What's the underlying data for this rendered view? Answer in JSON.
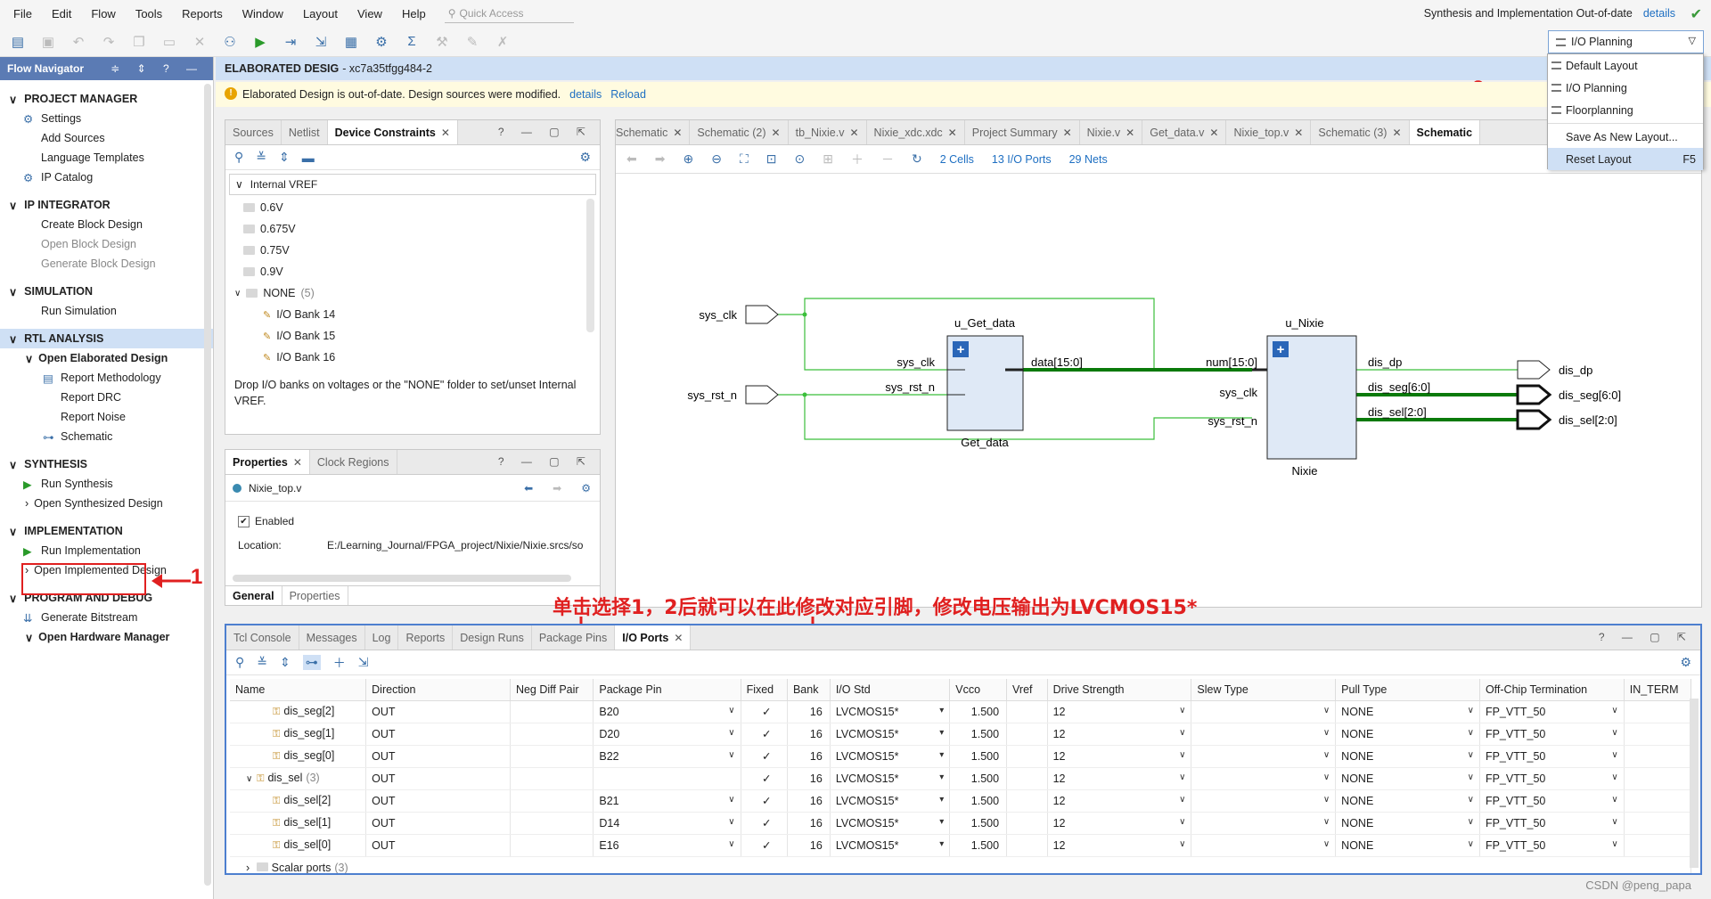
{
  "menubar": {
    "items": [
      "File",
      "Edit",
      "Flow",
      "Tools",
      "Reports",
      "Window",
      "Layout",
      "View",
      "Help"
    ],
    "quick_access_placeholder": "Quick Access",
    "status_text": "Synthesis and Implementation Out-of-date",
    "status_link": "details"
  },
  "toolbar": {
    "layout_selected": "I/O Planning"
  },
  "layout_menu": {
    "items": [
      "Default Layout",
      "I/O Planning",
      "Floorplanning",
      "Save As New Layout...",
      "Reset Layout"
    ],
    "reset_shortcut": "F5"
  },
  "flow_navigator": {
    "title": "Flow Navigator",
    "sections": [
      {
        "label": "PROJECT MANAGER",
        "items": [
          "Settings",
          "Add Sources",
          "Language Templates",
          "IP Catalog"
        ]
      },
      {
        "label": "IP INTEGRATOR",
        "items": [
          "Create Block Design",
          "Open Block Design",
          "Generate Block Design"
        ]
      },
      {
        "label": "SIMULATION",
        "items": [
          "Run Simulation"
        ]
      },
      {
        "label": "RTL ANALYSIS",
        "items": [
          "Open Elaborated Design",
          "Report Methodology",
          "Report DRC",
          "Report Noise",
          "Schematic"
        ]
      },
      {
        "label": "SYNTHESIS",
        "items": [
          "Run Synthesis",
          "Open Synthesized Design"
        ]
      },
      {
        "label": "IMPLEMENTATION",
        "items": [
          "Run Implementation",
          "Open Implemented Design"
        ]
      },
      {
        "label": "PROGRAM AND DEBUG",
        "items": [
          "Generate Bitstream",
          "Open Hardware Manager"
        ]
      }
    ]
  },
  "design_header": {
    "title": "ELABORATED DESIG",
    "part": "- xc7a35tfgg484-2",
    "warning": "Elaborated Design is out-of-date. Design sources were modified.",
    "details_link": "details",
    "reload_link": "Reload"
  },
  "device_constraints": {
    "tabs": [
      "Sources",
      "Netlist",
      "Device Constraints"
    ],
    "tree_root": "Internal VREF",
    "vrefs": [
      "0.6V",
      "0.675V",
      "0.75V",
      "0.9V"
    ],
    "none_label": "NONE",
    "none_count": "(5)",
    "banks": [
      "I/O Bank 14",
      "I/O Bank 15",
      "I/O Bank 16"
    ],
    "hint": "Drop I/O banks on voltages or the \"NONE\" folder to set/unset Internal VREF."
  },
  "properties": {
    "tabs": [
      "Properties",
      "Clock Regions"
    ],
    "object": "Nixie_top.v",
    "enabled_label": "Enabled",
    "location_label": "Location:",
    "location_value": "E:/Learning_Journal/FPGA_project/Nixie/Nixie.srcs/so",
    "bottom_tabs": [
      "General",
      "Properties"
    ]
  },
  "schematic": {
    "tabs": [
      "Schematic",
      "Schematic (2)",
      "tb_Nixie.v",
      "Nixie_xdc.xdc",
      "Project Summary",
      "Nixie.v",
      "Get_data.v",
      "Nixie_top.v",
      "Schematic (3)",
      "Schematic"
    ],
    "cells": "2 Cells",
    "io_ports": "13 I/O Ports",
    "nets": "29 Nets",
    "inputs": [
      "sys_clk",
      "sys_rst_n"
    ],
    "outputs": [
      "dis_dp",
      "dis_seg[6:0]",
      "dis_sel[2:0]"
    ],
    "get_data": {
      "inst": "u_Get_data",
      "name": "Get_data",
      "pins_in": [
        "sys_clk",
        "sys_rst_n"
      ],
      "pin_out": "data[15:0]"
    },
    "nixie": {
      "inst": "u_Nixie",
      "name": "Nixie",
      "pins_in": [
        "num[15:0]",
        "sys_clk",
        "sys_rst_n"
      ],
      "pins_out": [
        "dis_dp",
        "dis_seg[6:0]",
        "dis_sel[2:0]"
      ]
    }
  },
  "annotations": {
    "num1": "1",
    "num2": "2",
    "text": "单击选择1，2后就可以在此修改对应引脚，修改电压输出为LVCMOS15*"
  },
  "io_ports": {
    "tabs": [
      "Tcl Console",
      "Messages",
      "Log",
      "Reports",
      "Design Runs",
      "Package Pins",
      "I/O Ports"
    ],
    "columns": [
      "Name",
      "Direction",
      "Neg Diff Pair",
      "Package Pin",
      "Fixed",
      "Bank",
      "I/O Std",
      "Vcco",
      "Vref",
      "Drive Strength",
      "Slew Type",
      "Pull Type",
      "Off-Chip Termination",
      "IN_TERM"
    ],
    "rows": [
      {
        "name": "dis_seg[2]",
        "dir": "OUT",
        "pin": "B20",
        "bank": "16",
        "std": "LVCMOS15*",
        "vcco": "1.500",
        "drive": "12",
        "pull": "NONE",
        "term": "FP_VTT_50",
        "indent": 2,
        "group": false
      },
      {
        "name": "dis_seg[1]",
        "dir": "OUT",
        "pin": "D20",
        "bank": "16",
        "std": "LVCMOS15*",
        "vcco": "1.500",
        "drive": "12",
        "pull": "NONE",
        "term": "FP_VTT_50",
        "indent": 2,
        "group": false
      },
      {
        "name": "dis_seg[0]",
        "dir": "OUT",
        "pin": "B22",
        "bank": "16",
        "std": "LVCMOS15*",
        "vcco": "1.500",
        "drive": "12",
        "pull": "NONE",
        "term": "FP_VTT_50",
        "indent": 2,
        "group": false
      },
      {
        "name": "dis_sel",
        "count": "(3)",
        "dir": "OUT",
        "pin": "",
        "bank": "16",
        "std": "LVCMOS15*",
        "vcco": "1.500",
        "drive": "12",
        "pull": "NONE",
        "term": "FP_VTT_50",
        "indent": 1,
        "group": true
      },
      {
        "name": "dis_sel[2]",
        "dir": "OUT",
        "pin": "B21",
        "bank": "16",
        "std": "LVCMOS15*",
        "vcco": "1.500",
        "drive": "12",
        "pull": "NONE",
        "term": "FP_VTT_50",
        "indent": 2,
        "group": false
      },
      {
        "name": "dis_sel[1]",
        "dir": "OUT",
        "pin": "D14",
        "bank": "16",
        "std": "LVCMOS15*",
        "vcco": "1.500",
        "drive": "12",
        "pull": "NONE",
        "term": "FP_VTT_50",
        "indent": 2,
        "group": false
      },
      {
        "name": "dis_sel[0]",
        "dir": "OUT",
        "pin": "E16",
        "bank": "16",
        "std": "LVCMOS15*",
        "vcco": "1.500",
        "drive": "12",
        "pull": "NONE",
        "term": "FP_VTT_50",
        "indent": 2,
        "group": false
      }
    ],
    "scalar_label": "Scalar ports",
    "scalar_count": "(3)"
  },
  "watermark": "CSDN @peng_papa"
}
